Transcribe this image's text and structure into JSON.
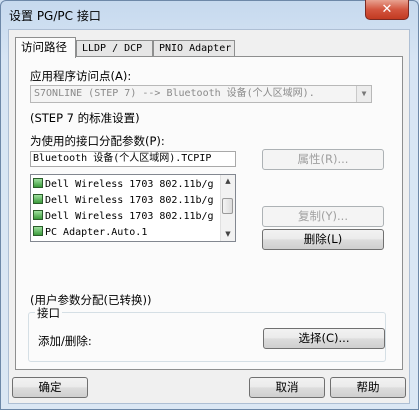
{
  "window": {
    "title": "设置 PG/PC 接口",
    "close_label": "✕"
  },
  "tabs": [
    {
      "label": "访问路径"
    },
    {
      "label": "LLDP / DCP"
    },
    {
      "label": "PNIO Adapter"
    }
  ],
  "access_point": {
    "label": "应用程序访问点(A):",
    "value": "S7ONLINE (STEP 7)      --> Bluetooth 设备(个人区域网).",
    "note": "(STEP 7 的标准设置)"
  },
  "interface_param": {
    "label": "为使用的接口分配参数(P):",
    "value": "Bluetooth 设备(个人区域网).TCPIP",
    "items": [
      "Dell Wireless 1703 802.11b/g",
      "Dell Wireless 1703 802.11b/g",
      "Dell Wireless 1703 802.11b/g",
      "PC Adapter.Auto.1"
    ],
    "status": "(用户参数分配(已转换))"
  },
  "buttons": {
    "properties": "属性(R)...",
    "copy": "复制(Y)...",
    "delete": "删除(L)",
    "select": "选择(C)...",
    "ok": "确定",
    "cancel": "取消",
    "help": "帮助"
  },
  "interfaces_group": {
    "title": "接口",
    "add_remove_label": "添加/删除:"
  }
}
